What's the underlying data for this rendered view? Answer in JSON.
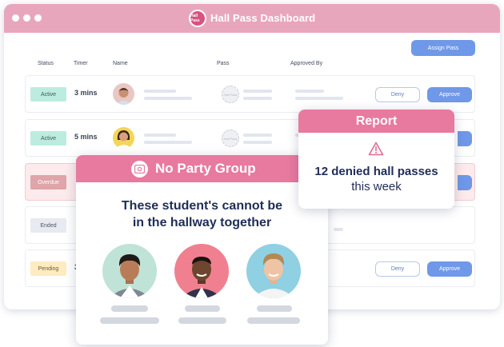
{
  "window": {
    "title": "Hall Pass Dashboard",
    "logo_text": "Hall Pass"
  },
  "toolbar": {
    "assign_label": "Assign Pass"
  },
  "columns": {
    "status": "Status",
    "timer": "Timer",
    "name": "Name",
    "pass": "Pass",
    "approved_by": "Approved By"
  },
  "rows": [
    {
      "status": "Active",
      "timer": "3 mins",
      "deny": "Deny",
      "approve": "Approve",
      "pass_icon_text": "Hall Pass"
    },
    {
      "status": "Active",
      "timer": "5 mins",
      "pass_icon_text": "Hall Pass"
    },
    {
      "status": "Overdue"
    },
    {
      "status": "Ended"
    },
    {
      "status": "Pending",
      "timer": "3",
      "deny": "Deny",
      "approve": "Approve"
    }
  ],
  "no_party_group": {
    "title": "No Party Group",
    "message_line1": "These student's cannot be",
    "message_line2": "in the hallway together"
  },
  "report": {
    "title": "Report",
    "headline": "12 denied hall passes",
    "period": "this week"
  },
  "colors": {
    "titlebar": "#e8a6bd",
    "card_header": "#e8799f",
    "primary_button": "#6f98e8",
    "heading_text": "#1f2d57"
  }
}
